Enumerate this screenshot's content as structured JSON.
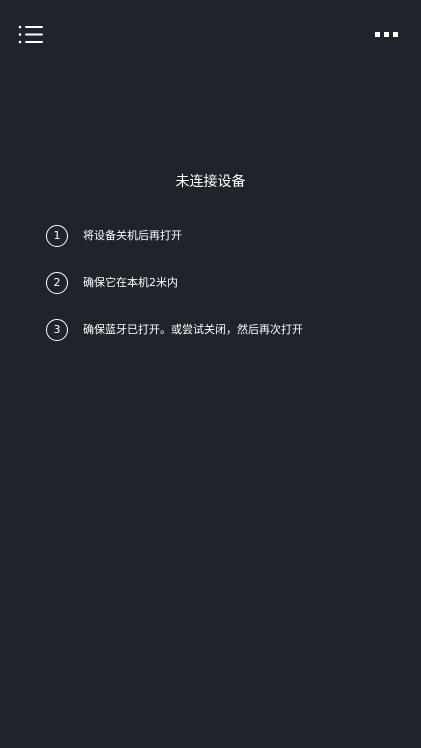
{
  "header": {
    "menu_icon": "list-menu-icon",
    "more_icon": "more-horizontal-icon"
  },
  "main": {
    "title": "未连接设备",
    "steps": [
      {
        "num": "1",
        "text": "将设备关机后再打开"
      },
      {
        "num": "2",
        "text": "确保它在本机2米内"
      },
      {
        "num": "3",
        "text": "确保蓝牙已打开。或尝试关闭，然后再次打开"
      }
    ]
  },
  "colors": {
    "background": "#1e232c",
    "text": "#ffffff"
  }
}
